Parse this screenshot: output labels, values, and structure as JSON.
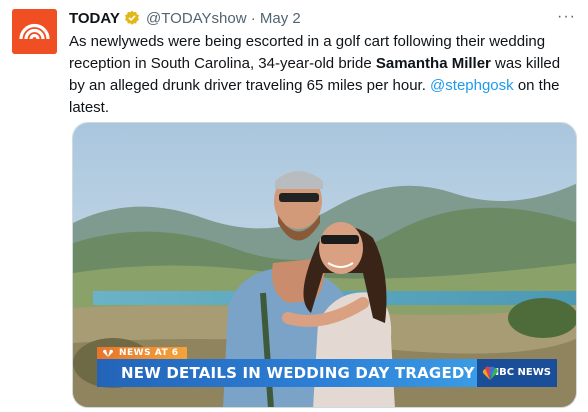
{
  "tweet": {
    "author_name": "TODAY",
    "handle": "@TODAYshow",
    "separator": "·",
    "date": "May 2",
    "more_label": "···",
    "text_part1": "As newlyweds were being escorted in a golf cart following their wedding reception in South Carolina, 34-year-old bride ",
    "text_bold": "Samantha Miller",
    "text_part2": " was killed by an alleged drunk driver traveling 65 miles per hour. ",
    "mention": "@stephgosk",
    "text_part3": " on the latest."
  },
  "media": {
    "kicker": "NEWS AT 6",
    "headline": "NEW DETAILS IN WEDDING DAY TRAGEDY",
    "network": "NBC NEWS"
  },
  "colors": {
    "avatar_bg": "#f04e23",
    "link": "#1d9bf0",
    "verified": "#e2b719",
    "chyron_blue": "#2d80d6",
    "kicker_orange": "#e8742b"
  },
  "icons": {
    "avatar": "today-logo-icon",
    "verified": "verified-badge-icon",
    "more": "more-options-icon",
    "network": "nbc-peacock-icon"
  }
}
